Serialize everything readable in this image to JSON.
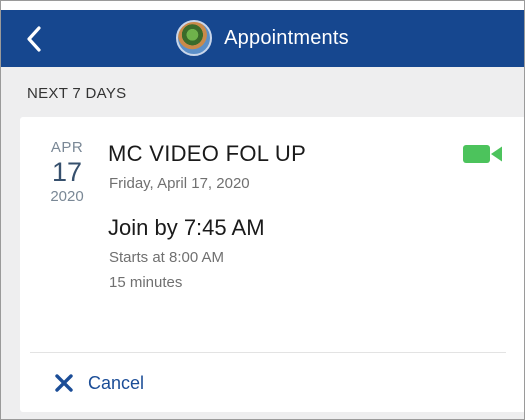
{
  "header": {
    "title": "Appointments",
    "back_icon": "chevron-left-icon",
    "avatar": "user-avatar"
  },
  "section": {
    "label": "NEXT 7 DAYS"
  },
  "appointment": {
    "date": {
      "month": "APR",
      "day": "17",
      "year": "2020"
    },
    "title": "MC VIDEO FOL UP",
    "full_date": "Friday, April 17, 2020",
    "join_by": "Join by 7:45 AM",
    "starts_at": "Starts at 8:00 AM",
    "duration": "15 minutes",
    "type_icon": "video-camera-icon"
  },
  "actions": {
    "cancel_label": "Cancel",
    "cancel_icon": "close-icon"
  },
  "colors": {
    "header_bg": "#16478f",
    "accent_blue": "#1b4d97",
    "video_green": "#4cc35c",
    "page_bg": "#eeeeef"
  }
}
